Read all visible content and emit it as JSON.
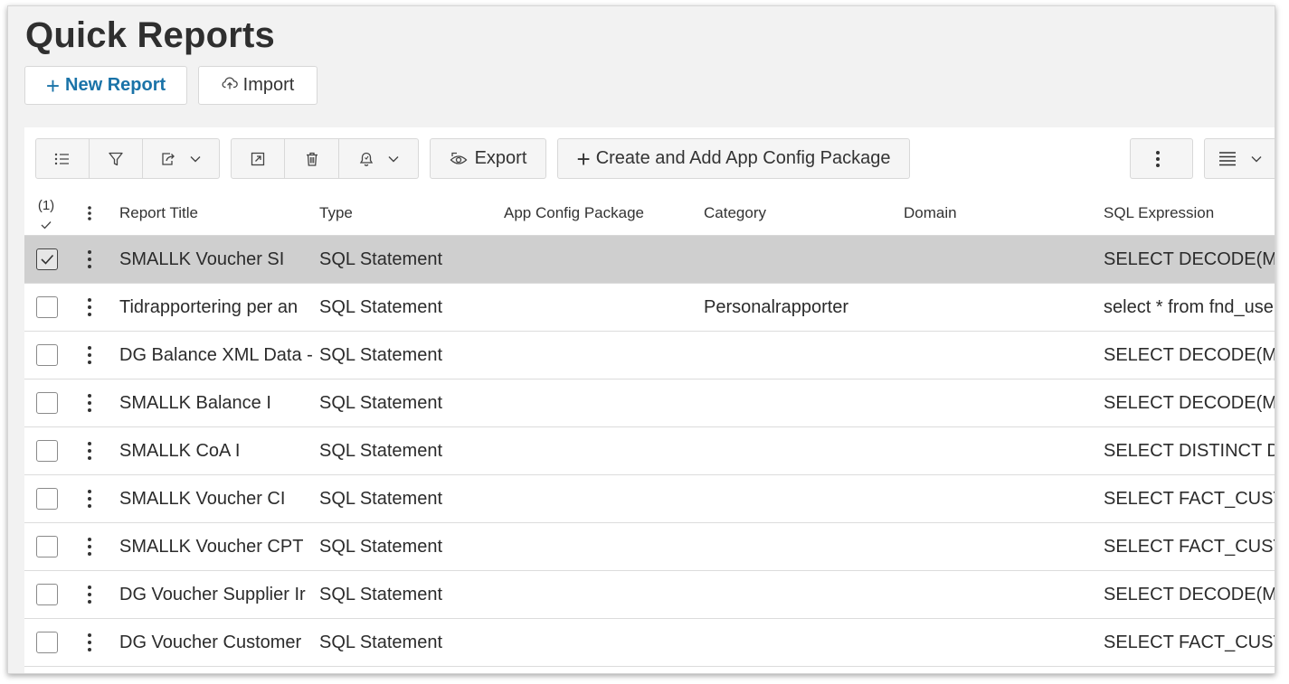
{
  "page": {
    "title": "Quick Reports"
  },
  "actions": {
    "new_report": "New Report",
    "import": "Import"
  },
  "toolbar": {
    "icons": [
      "list-settings-icon",
      "filter-icon",
      "share-icon",
      "chevron-down-icon",
      "open-icon",
      "trash-icon",
      "notify-icon",
      "chevron-down-icon",
      "more-icon",
      "table-view-icon"
    ],
    "export": "Export",
    "create_package": "Create and Add App Config Package"
  },
  "table": {
    "selected_count": "(1)",
    "columns": [
      "Report Title",
      "Type",
      "App Config Package",
      "Category",
      "Domain",
      "SQL Expression"
    ],
    "rows": [
      {
        "selected": true,
        "title": "SMALLK Voucher SI",
        "type": "SQL Statement",
        "package": "",
        "category": "",
        "domain": "",
        "sql": "SELECT DECODE(MIN"
      },
      {
        "selected": false,
        "title": "Tidrapportering per an",
        "type": "SQL Statement",
        "package": "",
        "category": "Personalrapporter",
        "domain": "",
        "sql": "select * from fnd_use"
      },
      {
        "selected": false,
        "title": "DG Balance XML Data -",
        "type": "SQL Statement",
        "package": "",
        "category": "",
        "domain": "",
        "sql": "SELECT DECODE(MIN"
      },
      {
        "selected": false,
        "title": "SMALLK Balance I",
        "type": "SQL Statement",
        "package": "",
        "category": "",
        "domain": "",
        "sql": "SELECT DECODE(MIN"
      },
      {
        "selected": false,
        "title": "SMALLK CoA I",
        "type": "SQL Statement",
        "package": "",
        "category": "",
        "domain": "",
        "sql": "SELECT DISTINCT DIM"
      },
      {
        "selected": false,
        "title": "SMALLK Voucher CI",
        "type": "SQL Statement",
        "package": "",
        "category": "",
        "domain": "",
        "sql": "SELECT FACT_CUSTO"
      },
      {
        "selected": false,
        "title": "SMALLK Voucher CPT",
        "type": "SQL Statement",
        "package": "",
        "category": "",
        "domain": "",
        "sql": "SELECT FACT_CUST_P"
      },
      {
        "selected": false,
        "title": "DG Voucher Supplier Ir",
        "type": "SQL Statement",
        "package": "",
        "category": "",
        "domain": "",
        "sql": "SELECT DECODE(MIN"
      },
      {
        "selected": false,
        "title": "DG Voucher Customer",
        "type": "SQL Statement",
        "package": "",
        "category": "",
        "domain": "",
        "sql": "SELECT FACT_CUSTO"
      }
    ]
  },
  "colors": {
    "accent": "#1a73a8",
    "selected_row": "#cfcfcf",
    "page_bg": "#f2f2f2"
  }
}
